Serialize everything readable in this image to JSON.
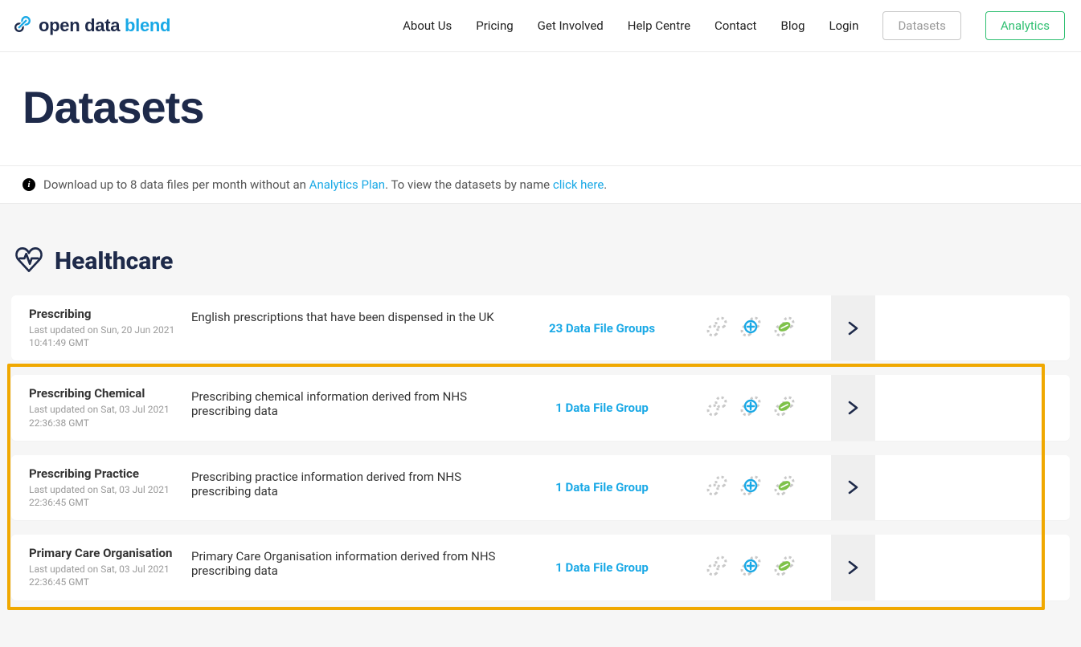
{
  "brand": {
    "part1": "open data ",
    "part2": "blend"
  },
  "nav": {
    "about": "About Us",
    "pricing": "Pricing",
    "get_involved": "Get Involved",
    "help": "Help Centre",
    "contact": "Contact",
    "blog": "Blog",
    "login": "Login",
    "datasets_btn": "Datasets",
    "analytics_btn": "Analytics"
  },
  "page_title": "Datasets",
  "info": {
    "prefix": "Download up to 8 data files per month without an ",
    "link1": "Analytics Plan",
    "mid": ". To view the datasets by name ",
    "link2": "click here",
    "suffix": "."
  },
  "section_title": "Healthcare",
  "datasets": [
    {
      "name": "Prescribing",
      "updated_prefix": "Last updated on ",
      "updated_date": "Sun, 20 Jun 2021 10:41:49 GMT",
      "description": "English prescriptions that have been dispensed in the UK",
      "groups": "23 Data File Groups"
    },
    {
      "name": "Prescribing Chemical",
      "updated_prefix": "Last updated on ",
      "updated_date": "Sat, 03 Jul 2021 22:36:38 GMT",
      "description": "Prescribing chemical information derived from NHS prescribing data",
      "groups": "1 Data File Group"
    },
    {
      "name": "Prescribing Practice",
      "updated_prefix": "Last updated on ",
      "updated_date": "Sat, 03 Jul 2021 22:36:45 GMT",
      "description": "Prescribing practice information derived from NHS prescribing data",
      "groups": "1 Data File Group"
    },
    {
      "name": "Primary Care Organisation",
      "updated_prefix": "Last updated on ",
      "updated_date": "Sat, 03 Jul 2021 22:36:45 GMT",
      "description": "Primary Care Organisation information derived from NHS prescribing data",
      "groups": "1 Data File Group"
    }
  ]
}
